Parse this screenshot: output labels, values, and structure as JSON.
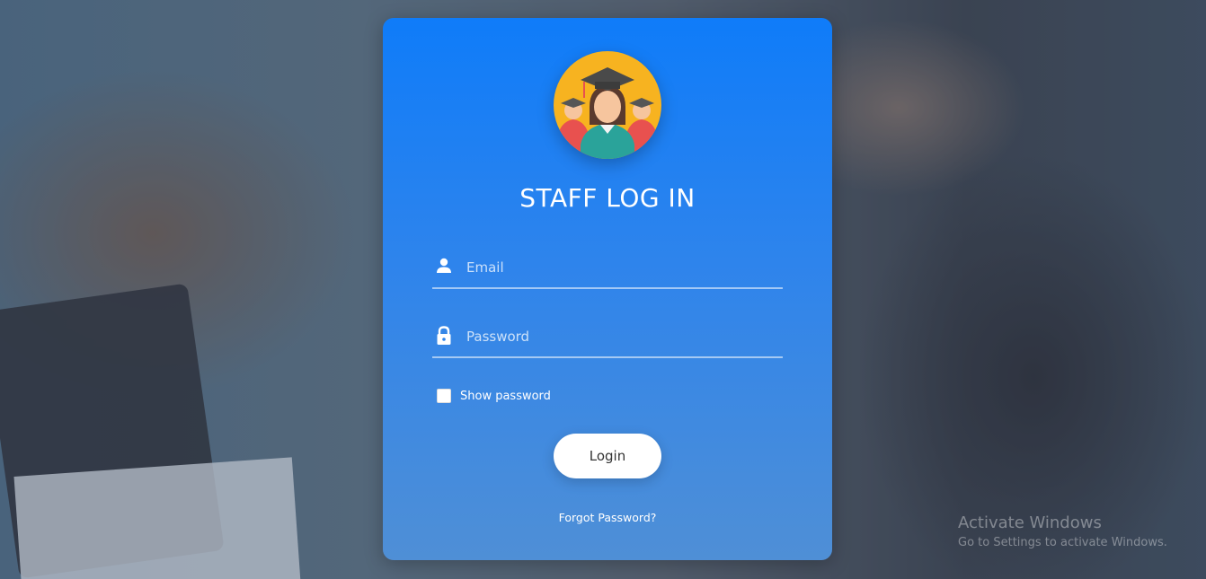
{
  "login_card": {
    "title": "STAFF LOG IN",
    "email": {
      "placeholder": "Email",
      "value": "",
      "icon": "person-icon"
    },
    "password": {
      "placeholder": "Password",
      "value": "",
      "icon": "lock-icon"
    },
    "show_password": {
      "label": "Show password",
      "checked": false
    },
    "login_button": "Login",
    "forgot_password": "Forgot Password?"
  },
  "windows_watermark": {
    "line1": "Activate Windows",
    "line2": "Go to Settings to activate Windows."
  },
  "colors": {
    "card_top": "#0f7cf9",
    "card_bottom": "#4f8fd6",
    "avatar_bg": "#f7b320"
  }
}
